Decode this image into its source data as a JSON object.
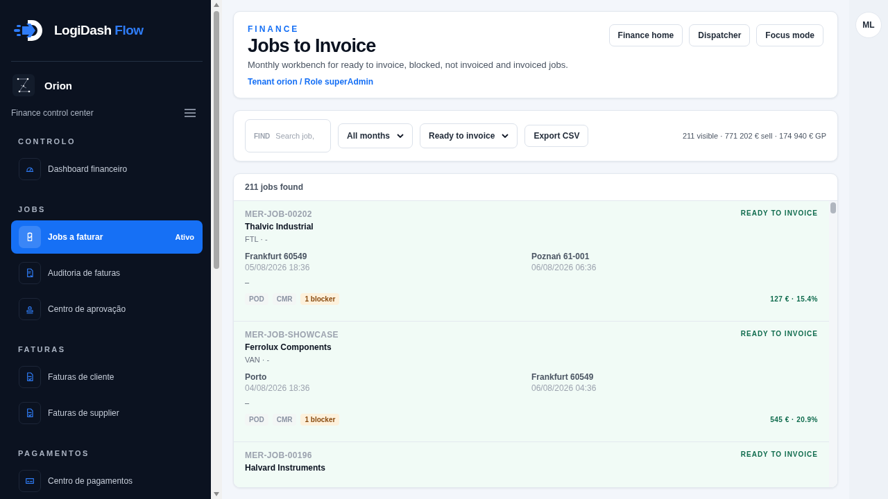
{
  "brand": {
    "name": "LogiDash",
    "accent": "Flow"
  },
  "tenant": {
    "name": "Orion",
    "subtitle": "Finance control center"
  },
  "nav": [
    {
      "heading": "CONTROLO",
      "items": [
        {
          "label": "Dashboard financeiro",
          "selected": false
        }
      ]
    },
    {
      "heading": "JOBS",
      "items": [
        {
          "label": "Jobs a faturar",
          "selected": true,
          "badge": "Ativo"
        },
        {
          "label": "Auditoria de faturas",
          "selected": false
        },
        {
          "label": "Centro de aprovação",
          "selected": false
        }
      ]
    },
    {
      "heading": "FATURAS",
      "items": [
        {
          "label": "Faturas de cliente",
          "selected": false
        },
        {
          "label": "Faturas de supplier",
          "selected": false
        }
      ]
    },
    {
      "heading": "PAGAMENTOS",
      "items": [
        {
          "label": "Centro de pagamentos",
          "selected": false
        }
      ]
    }
  ],
  "header": {
    "eyebrow": "FINANCE",
    "title": "Jobs to Invoice",
    "description": "Monthly workbench for ready to invoice, blocked, not invoiced and invoiced jobs.",
    "context": "Tenant orion / Role superAdmin",
    "buttons": [
      "Finance home",
      "Dispatcher",
      "Focus mode"
    ]
  },
  "filters": {
    "find_label": "FIND",
    "search": {
      "placeholder": "Search job,"
    },
    "month": "All months",
    "status": "Ready to invoice",
    "export": "Export CSV",
    "summary": "211 visible · 771 202 € sell · 174 940 € GP"
  },
  "results": {
    "count": "211 jobs found",
    "jobs": [
      {
        "id": "MER-JOB-00202",
        "customer": "Thalvic Industrial",
        "meta": "FTL · -",
        "status": "READY TO INVOICE",
        "from": {
          "place": "Frankfurt 60549",
          "time": "05/08/2026 18:36"
        },
        "to": {
          "place": "Poznań 61-001",
          "time": "06/08/2026 06:36"
        },
        "note": "–",
        "tags": [
          {
            "label": "POD",
            "kind": "doc"
          },
          {
            "label": "CMR",
            "kind": "doc"
          },
          {
            "label": "1 blocker",
            "kind": "blocker"
          }
        ],
        "margin": "127 € · 15.4%"
      },
      {
        "id": "MER-JOB-SHOWCASE",
        "customer": "Ferrolux Components",
        "meta": "VAN · -",
        "status": "READY TO INVOICE",
        "from": {
          "place": "Porto",
          "time": "04/08/2026 18:36"
        },
        "to": {
          "place": "Frankfurt 60549",
          "time": "06/08/2026 04:36"
        },
        "note": "–",
        "tags": [
          {
            "label": "POD",
            "kind": "doc"
          },
          {
            "label": "CMR",
            "kind": "doc"
          },
          {
            "label": "1 blocker",
            "kind": "blocker"
          }
        ],
        "margin": "545 € · 20.9%"
      },
      {
        "id": "MER-JOB-00196",
        "customer": "Halvard Instruments",
        "status": "READY TO INVOICE"
      }
    ]
  },
  "user": {
    "initials": "ML"
  }
}
